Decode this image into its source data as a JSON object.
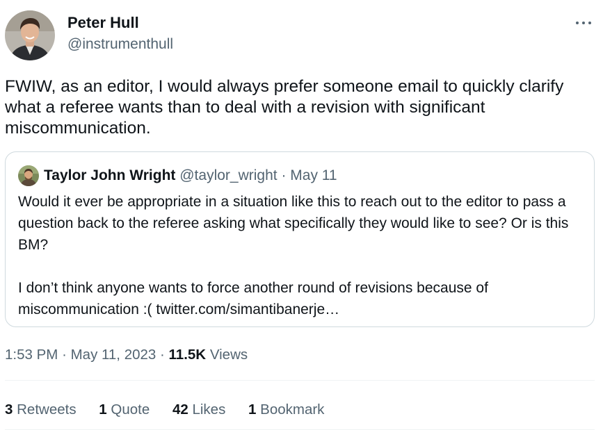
{
  "author": {
    "name": "Peter Hull",
    "handle": "@instrumenthull"
  },
  "more_icon": "more-horizontal-icon",
  "tweet_text": "FWIW, as an editor, I would always prefer someone email to quickly clarify what a referee wants than to deal with a revision with significant miscommunication.",
  "quote": {
    "name": "Taylor John Wright",
    "handle": "@taylor_wright",
    "separator": "·",
    "date": "May 11",
    "paragraphs": [
      "Would it ever be appropriate in a situation like this to reach out to the editor to pass a question back to the referee asking what specifically they would like to see? Or is this BM?",
      "I don’t think anyone wants to force another round of revisions because of miscommunication :( twitter.com/simantibanerje…"
    ]
  },
  "meta": {
    "time": "1:53 PM",
    "separator": "·",
    "date": "May 11, 2023",
    "views_count": "11.5K",
    "views_label": "Views"
  },
  "stats": [
    {
      "count": "3",
      "label": "Retweets"
    },
    {
      "count": "1",
      "label": "Quote"
    },
    {
      "count": "42",
      "label": "Likes"
    },
    {
      "count": "1",
      "label": "Bookmark"
    }
  ],
  "colors": {
    "text_primary": "#0f1419",
    "text_secondary": "#536471",
    "border": "#cfd9de",
    "divider": "#eff3f4"
  }
}
